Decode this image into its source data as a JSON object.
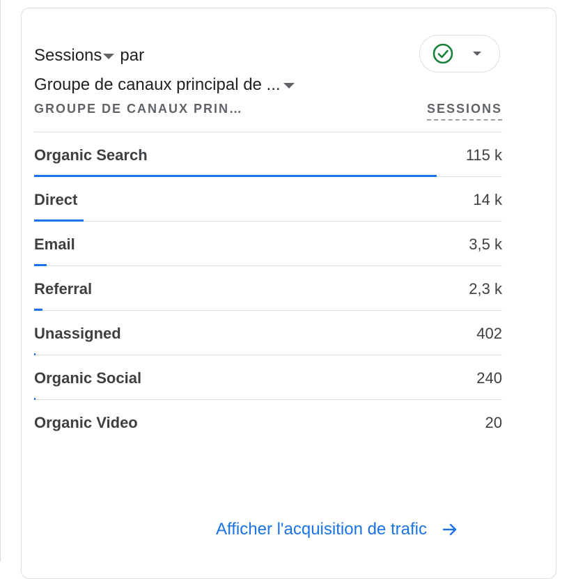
{
  "card": {
    "title": {
      "metric": "Sessions",
      "connector": "par",
      "dimension": "Groupe de canaux principal de ..."
    },
    "compare_button": {
      "icon": "check-circle-icon",
      "dropdown_icon": "caret-down-icon",
      "icon_color": "#188038"
    },
    "columns": {
      "dimension": "GROUPE DE CANAUX PRIN…",
      "metric": "SESSIONS"
    },
    "rows": [
      {
        "label": "Organic Search",
        "value": "115 k",
        "share": 1.0
      },
      {
        "label": "Direct",
        "value": "14 k",
        "share": 0.122
      },
      {
        "label": "Email",
        "value": "3,5 k",
        "share": 0.031
      },
      {
        "label": "Referral",
        "value": "2,3 k",
        "share": 0.02
      },
      {
        "label": "Unassigned",
        "value": "402",
        "share": 0.0035
      },
      {
        "label": "Organic Social",
        "value": "240",
        "share": 0.0021
      },
      {
        "label": "Organic Video",
        "value": "20",
        "share": 0.0002
      }
    ],
    "footer_link": {
      "label": "Afficher l'acquisition de trafic",
      "icon": "arrow-right-icon"
    }
  },
  "colors": {
    "accent": "#1a73e8",
    "border": "#dadce0",
    "text": "#3c4043"
  }
}
